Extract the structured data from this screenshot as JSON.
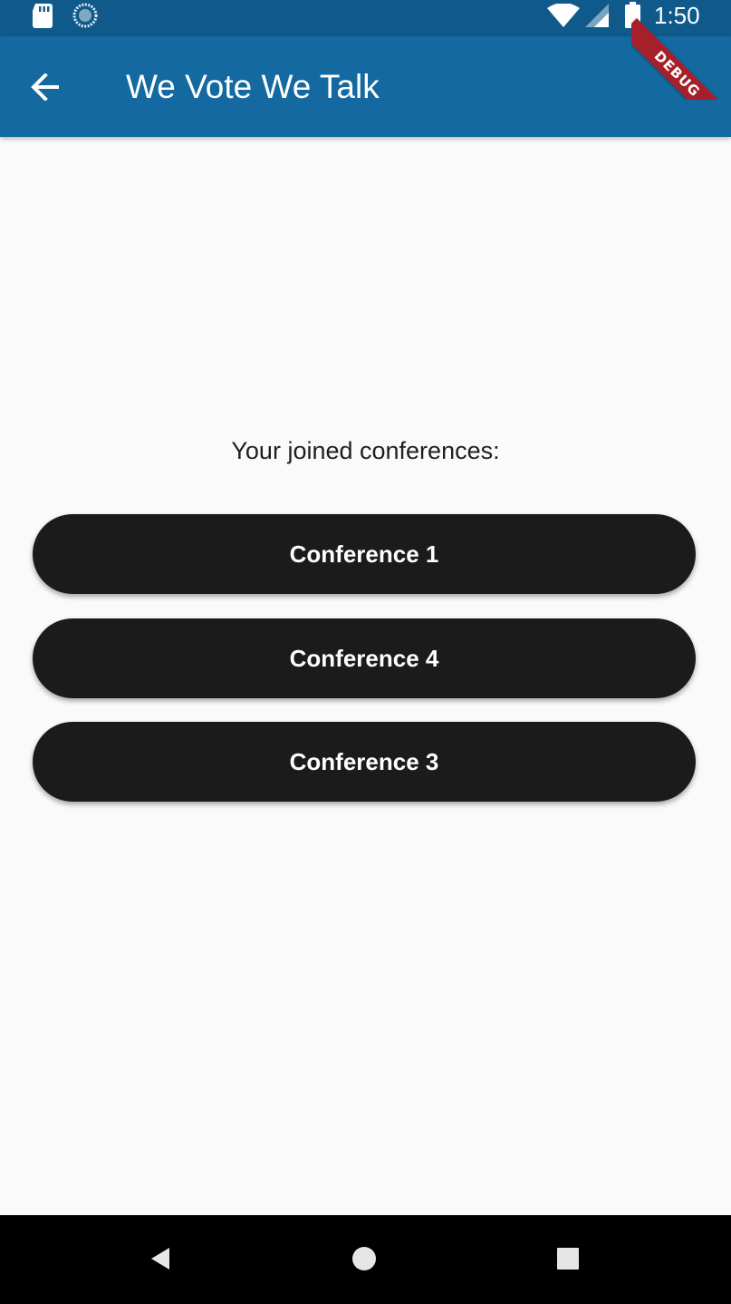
{
  "status_bar": {
    "time": "1:50",
    "icons": [
      "sd-card-icon",
      "sync-icon",
      "wifi-icon",
      "cell-signal-icon",
      "battery-icon"
    ]
  },
  "debug_banner": {
    "label": "DEBUG"
  },
  "app_bar": {
    "title": "We Vote We Talk",
    "back_icon": "arrow-back-icon",
    "color": "#1369a0"
  },
  "main": {
    "heading": "Your joined conferences:",
    "conferences": [
      {
        "label": "Conference 1"
      },
      {
        "label": "Conference 4"
      },
      {
        "label": "Conference 3"
      }
    ]
  },
  "nav_bar": {
    "buttons": [
      "back-triangle-icon",
      "home-circle-icon",
      "recents-square-icon"
    ]
  }
}
